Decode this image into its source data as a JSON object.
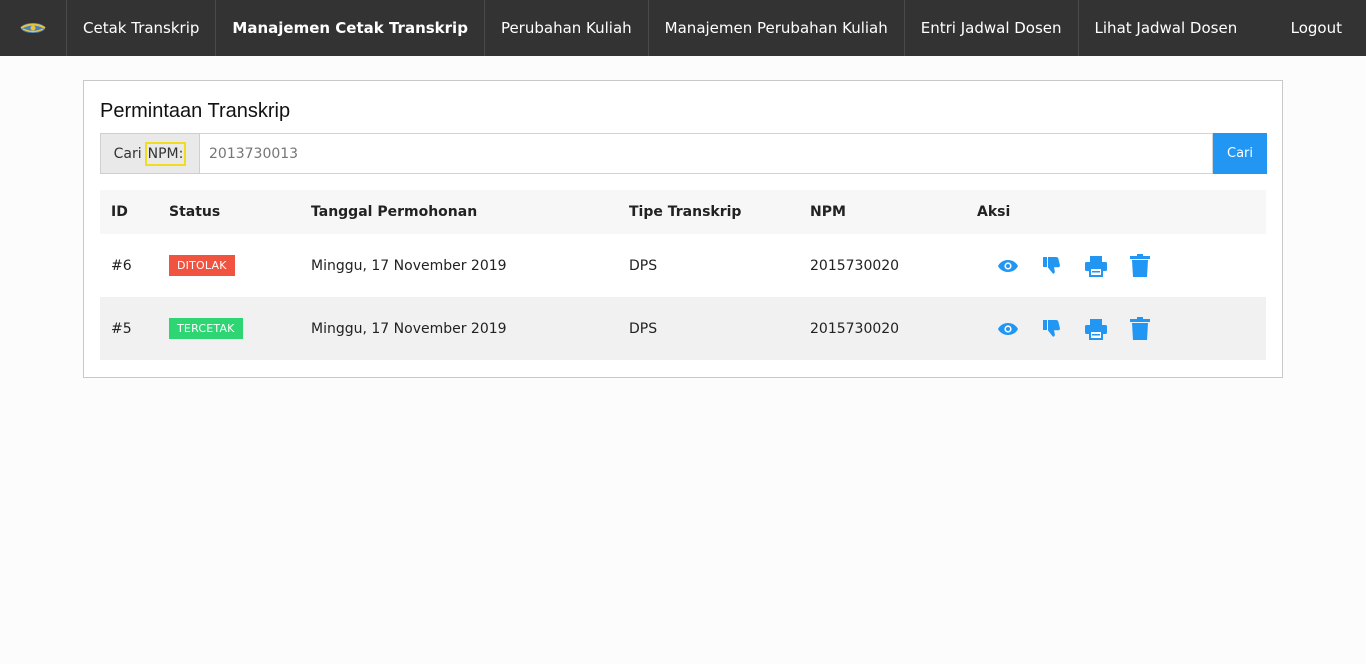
{
  "nav": {
    "items": [
      {
        "label": "Cetak Transkrip",
        "active": false
      },
      {
        "label": "Manajemen Cetak Transkrip",
        "active": true
      },
      {
        "label": "Perubahan Kuliah",
        "active": false
      },
      {
        "label": "Manajemen Perubahan Kuliah",
        "active": false
      },
      {
        "label": "Entri Jadwal Dosen",
        "active": false
      },
      {
        "label": "Lihat Jadwal Dosen",
        "active": false
      }
    ],
    "logout": "Logout"
  },
  "panel": {
    "title": "Permintaan Transkrip",
    "search": {
      "label_prefix": "Cari",
      "label_npm": "NPM:",
      "placeholder": "2013730013",
      "button": "Cari"
    },
    "table": {
      "headers": [
        "ID",
        "Status",
        "Tanggal Permohonan",
        "Tipe Transkrip",
        "NPM",
        "Aksi"
      ],
      "rows": [
        {
          "id": "#6",
          "status": "DITOLAK",
          "status_color": "#f0533f",
          "date": "Minggu, 17 November 2019",
          "type": "DPS",
          "npm": "2015730020"
        },
        {
          "id": "#5",
          "status": "TERCETAK",
          "status_color": "#2ed573",
          "date": "Minggu, 17 November 2019",
          "type": "DPS",
          "npm": "2015730020"
        }
      ],
      "action_icons": [
        "eye-icon",
        "thumbs-down-icon",
        "print-icon",
        "trash-icon"
      ]
    }
  },
  "colors": {
    "navbar": "#333333",
    "accent": "#2196f3",
    "highlight": "#f2dc1f"
  }
}
